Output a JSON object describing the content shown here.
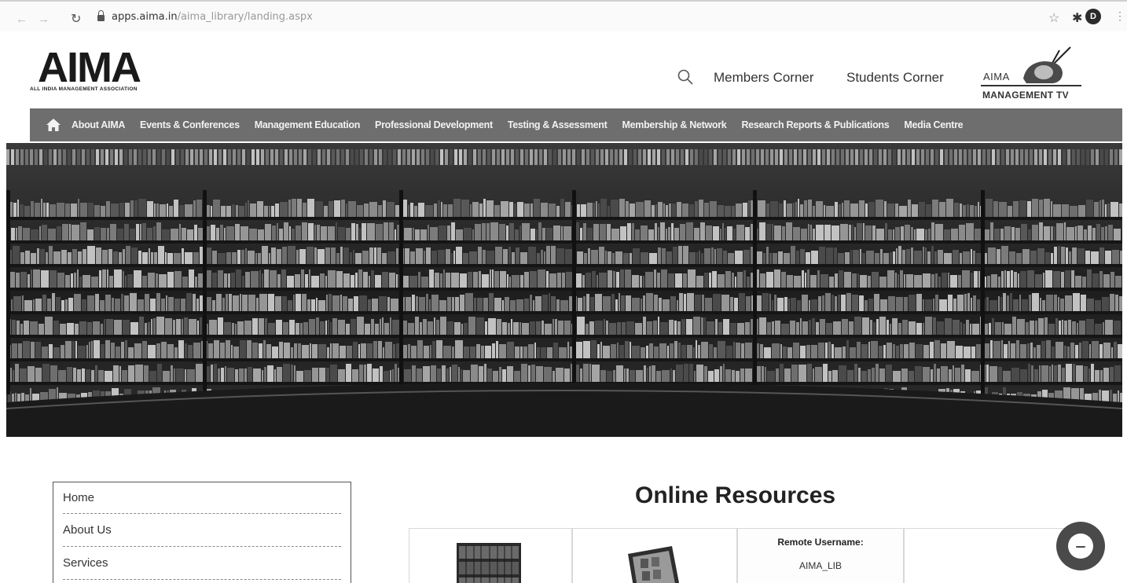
{
  "browser": {
    "url_host": "apps.aima.in",
    "url_path": "/aima_library/landing.aspx",
    "profile_initial": "D"
  },
  "header": {
    "logo_text": "AIMA",
    "logo_tagline": "ALL INDIA MANAGEMENT ASSOCIATION",
    "members_corner": "Members Corner",
    "students_corner": "Students Corner",
    "tv_logo_top": "AIMA",
    "tv_logo_bottom": "MANAGEMENT TV"
  },
  "nav": {
    "items": [
      "About AIMA",
      "Events & Conferences",
      "Management Education",
      "Professional Development",
      "Testing & Assessment",
      "Membership & Network",
      "Research Reports & Publications",
      "Media Centre"
    ]
  },
  "sidebar": {
    "items": [
      "Home",
      "About Us",
      "Services"
    ]
  },
  "resources": {
    "title": "Online Resources",
    "remote_username_label": "Remote Username:",
    "remote_username_value": "AIMA_LIB"
  },
  "colors": {
    "nav_bg": "#6e6e6e",
    "text": "#222222",
    "chat_bubble": "#4a4a4a"
  }
}
